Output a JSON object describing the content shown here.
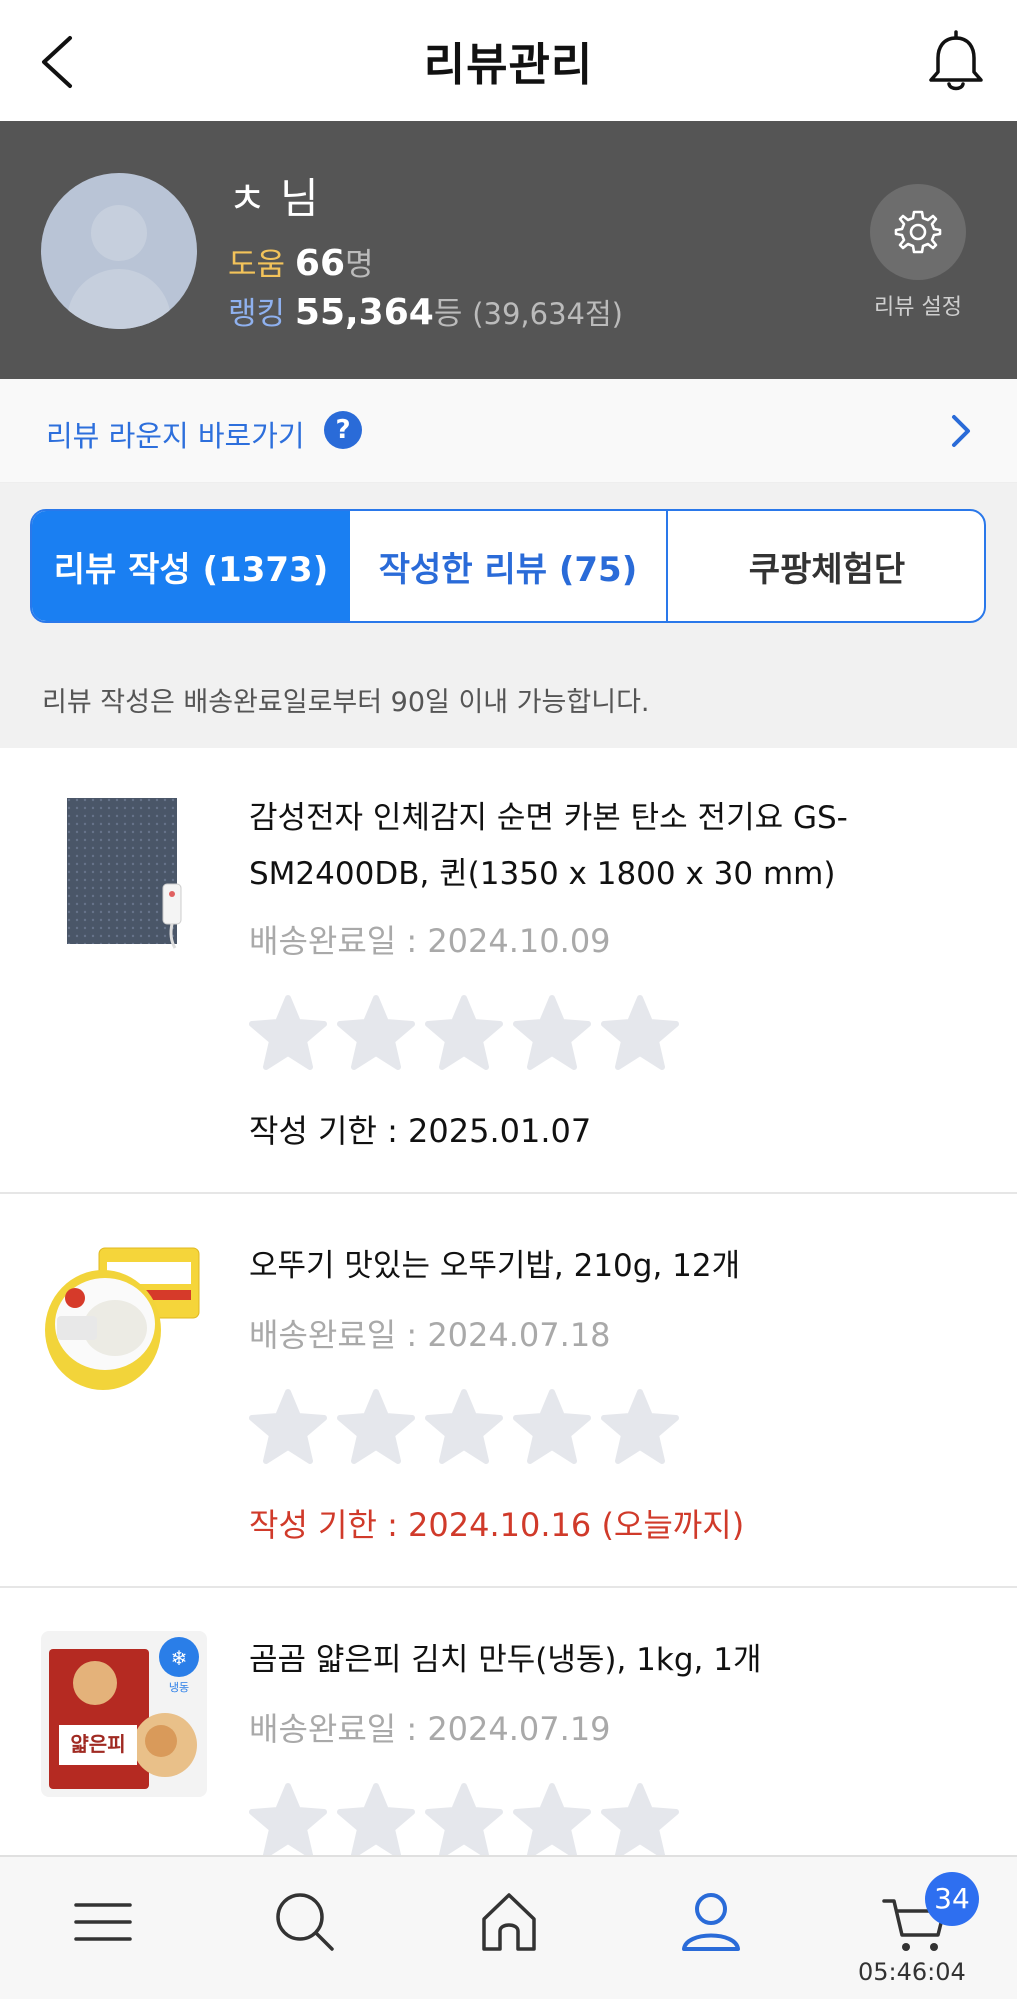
{
  "header": {
    "title": "리뷰관리"
  },
  "profile": {
    "name": "ㅊ 님",
    "help_label": "도움",
    "help_count": "66",
    "help_unit": "명",
    "rank_label": "랭킹",
    "rank_value": "55,364",
    "rank_unit": "등",
    "rank_points": "(39,634점)",
    "settings_label": "리뷰 설정"
  },
  "lounge": {
    "label": "리뷰 라운지 바로가기",
    "help_glyph": "?"
  },
  "tabs": [
    {
      "label": "리뷰 작성 (1373)",
      "active": true
    },
    {
      "label": "작성한 리뷰 (75)",
      "active": false
    },
    {
      "label": "쿠팡체험단",
      "active": false
    }
  ],
  "notice": "리뷰 작성은 배송완료일로부터 90일 이내 가능합니다.",
  "products": [
    {
      "title": "감성전자 인체감지 순면 카본 탄소 전기요 GS-SM2400DB, 퀸(1350 x 1800 x 30 mm)",
      "delivered": "배송완료일 : 2024.10.09",
      "deadline": "작성 기한 : 2025.01.07",
      "deadline_urgent": false,
      "rating": 0
    },
    {
      "title": "오뚜기 맛있는 오뚜기밥, 210g, 12개",
      "delivered": "배송완료일 : 2024.07.18",
      "deadline": "작성 기한 : 2024.10.16 (오늘까지)",
      "deadline_urgent": true,
      "rating": 0
    },
    {
      "title": "곰곰 얇은피 김치 만두(냉동), 1kg, 1개",
      "delivered": "배송완료일 : 2024.07.19",
      "rating": 0,
      "thumb_badge": "냉동",
      "package_text": "얇은피"
    }
  ],
  "bottom_nav": {
    "items": [
      "menu-icon",
      "search-icon",
      "home-icon",
      "my-account-icon",
      "cart-icon"
    ],
    "cart_count": "34",
    "time": "05:46:04"
  },
  "colors": {
    "accent": "#1a7ff2",
    "profile_bg": "#555555",
    "help_color": "#f3c35a",
    "rank_color": "#8fb1ef",
    "urgent": "#d03a2a",
    "star_empty": "#e5e7ec"
  }
}
